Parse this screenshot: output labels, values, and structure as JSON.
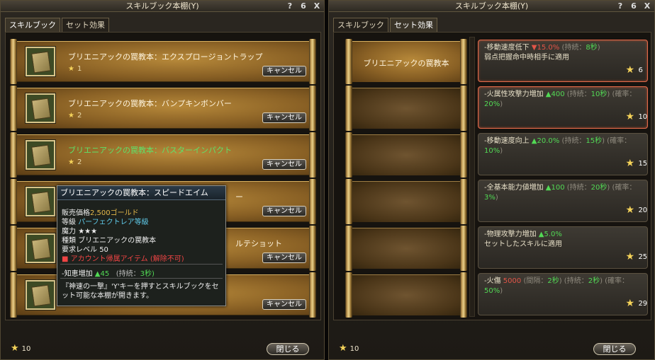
{
  "left": {
    "title": "スキルブック本棚(Y)",
    "title_icons": [
      "?",
      "6",
      "X"
    ],
    "tabs": [
      "スキルブック",
      "セット効果"
    ],
    "books": [
      {
        "name": "ブリエニアックの罠教本：エクスプロージョントラップ",
        "stars": "1",
        "cancel": "キャンセル"
      },
      {
        "name": "ブリエニアックの罠教本：バンプキンボンバー",
        "stars": "2",
        "cancel": "キャンセル"
      },
      {
        "name": "ブリエニアックの罠教本：バスターインパクト",
        "stars": "2",
        "cancel": "キャンセル"
      },
      {
        "name": "",
        "stars": "",
        "cancel": "キャンセル"
      },
      {
        "name": "",
        "stars": "",
        "cancel": "キャンセル"
      },
      {
        "name": "",
        "stars": "",
        "cancel": "キャンセル"
      }
    ],
    "partial_text": {
      "r4": "ー",
      "r5": "ルテショット"
    },
    "footer_stars": "10",
    "close": "閉じる"
  },
  "tooltip": {
    "title": "ブリエニアックの罠教本：スピードエイム",
    "price_label": "販売価格",
    "price_value": "2,500ゴールド",
    "grade_label": "等級",
    "grade_value": "パーフェクトレア等級",
    "magic_label": "魔力",
    "magic_value": "★★★",
    "type_label": "種類",
    "type_value": "ブリエニアックの罠教本",
    "level_label": "要求レベル",
    "level_value": "50",
    "bind": "アカウント帰属アイテム (解除不可)",
    "stat_label": "-知恵増加",
    "stat_value": "▲45",
    "duration_label": "(持続：",
    "duration_value": "3秒)",
    "desc": "『神速の一撃』'Y'キーを押すとスキルブックをセット可能な本棚が開きます。"
  },
  "right": {
    "title": "スキルブック本棚(Y)",
    "title_icons": [
      "?",
      "6",
      "X"
    ],
    "tabs": [
      "スキルブック",
      "セット効果"
    ],
    "slot_label": "ブリエニアックの罠教本",
    "effects": [
      {
        "text_a": "-移動速度低下 ",
        "red": "▼15.0%",
        "text_b": "(持続：",
        "green": "8秒",
        "text_c": ")",
        "line2": "弱点把握命中時相手に適用",
        "stars": "6"
      },
      {
        "text_a": "-火属性攻撃力増加 ",
        "green": "▲400",
        "text_b": "(持続：",
        "green2": "10秒",
        "text_c": ") (確率：",
        "green3": "20%",
        "text_d": ")",
        "stars": "10"
      },
      {
        "text_a": "-移動速度向上 ",
        "green": "▲20.0%",
        "text_b": "(持続：",
        "green2": "15秒",
        "text_c": ") (確率：",
        "green3": "10%",
        "text_d": ")",
        "stars": "15"
      },
      {
        "text_a": "-全基本能力値増加 ",
        "green": "▲100",
        "text_b": "(持続：",
        "green2": "20秒",
        "text_c": ") (確率：",
        "green3": "3%",
        "text_d": ")",
        "stars": "20"
      },
      {
        "text_a": "-物理攻撃力増加 ",
        "green": "▲5.0%",
        "line2": "セットしたスキルに適用",
        "stars": "25"
      },
      {
        "text_a": "-火傷 ",
        "red": "5000",
        "text_b": "(間隔：",
        "green": "2秒",
        "text_c": ") (持続：",
        "green2": "2秒",
        "text_d": ") (確率：",
        "green3": "50%",
        "text_e": ")",
        "stars": "29"
      }
    ],
    "footer_stars": "10",
    "close": "閉じる"
  },
  "colors": {
    "accent_gold": "#f5d35a",
    "stat_green": "#52d955",
    "stat_red": "#e25548",
    "highlight_border": "#e36b4b",
    "tooltip_cyan": "#5fc9e8"
  }
}
